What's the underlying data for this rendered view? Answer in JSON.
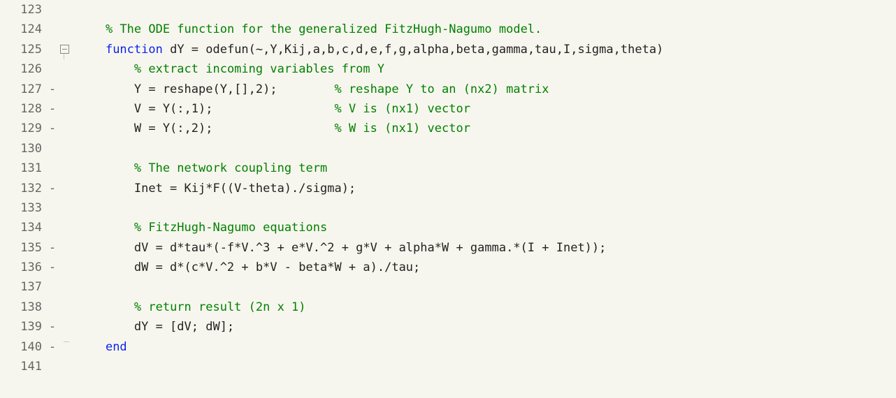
{
  "lines": [
    {
      "num": "123",
      "marker": "",
      "fold": "",
      "segs": []
    },
    {
      "num": "124",
      "marker": "",
      "fold": "",
      "segs": [
        {
          "cls": "text",
          "t": "    "
        },
        {
          "cls": "comment",
          "t": "% The ODE function for the generalized FitzHugh-Nagumo model."
        }
      ]
    },
    {
      "num": "125",
      "marker": "",
      "fold": "box",
      "segs": [
        {
          "cls": "text",
          "t": "    "
        },
        {
          "cls": "keyword",
          "t": "function "
        },
        {
          "cls": "text",
          "t": "dY = odefun(~,Y,Kij,a,b,c,d,e,f,g,alpha,beta,gamma,tau,I,sigma,theta)"
        }
      ]
    },
    {
      "num": "126",
      "marker": "",
      "fold": "line",
      "segs": [
        {
          "cls": "text",
          "t": "        "
        },
        {
          "cls": "comment",
          "t": "% extract incoming variables from Y"
        }
      ]
    },
    {
      "num": "127",
      "marker": "-",
      "fold": "line",
      "segs": [
        {
          "cls": "text",
          "t": "        Y = reshape(Y,[],2);        "
        },
        {
          "cls": "comment",
          "t": "% reshape Y to an (nx2) matrix"
        }
      ]
    },
    {
      "num": "128",
      "marker": "-",
      "fold": "line",
      "segs": [
        {
          "cls": "text",
          "t": "        V = Y(:,1);                 "
        },
        {
          "cls": "comment",
          "t": "% V is (nx1) vector"
        }
      ]
    },
    {
      "num": "129",
      "marker": "-",
      "fold": "line",
      "segs": [
        {
          "cls": "text",
          "t": "        W = Y(:,2);                 "
        },
        {
          "cls": "comment",
          "t": "% W is (nx1) vector"
        }
      ]
    },
    {
      "num": "130",
      "marker": "",
      "fold": "line",
      "segs": []
    },
    {
      "num": "131",
      "marker": "",
      "fold": "line",
      "segs": [
        {
          "cls": "text",
          "t": "        "
        },
        {
          "cls": "comment",
          "t": "% The network coupling term"
        }
      ]
    },
    {
      "num": "132",
      "marker": "-",
      "fold": "line",
      "segs": [
        {
          "cls": "text",
          "t": "        Inet = Kij*F((V-theta)./sigma);"
        }
      ]
    },
    {
      "num": "133",
      "marker": "",
      "fold": "line",
      "segs": []
    },
    {
      "num": "134",
      "marker": "",
      "fold": "line",
      "segs": [
        {
          "cls": "text",
          "t": "        "
        },
        {
          "cls": "comment",
          "t": "% FitzHugh-Nagumo equations"
        }
      ]
    },
    {
      "num": "135",
      "marker": "-",
      "fold": "line",
      "segs": [
        {
          "cls": "text",
          "t": "        dV = d*tau*(-f*V.^3 + e*V.^2 + g*V + alpha*W + gamma.*(I + Inet));"
        }
      ]
    },
    {
      "num": "136",
      "marker": "-",
      "fold": "line",
      "segs": [
        {
          "cls": "text",
          "t": "        dW = d*(c*V.^2 + b*V - beta*W + a)./tau;"
        }
      ]
    },
    {
      "num": "137",
      "marker": "",
      "fold": "line",
      "segs": []
    },
    {
      "num": "138",
      "marker": "",
      "fold": "line",
      "segs": [
        {
          "cls": "text",
          "t": "        "
        },
        {
          "cls": "comment",
          "t": "% return result (2n x 1)"
        }
      ]
    },
    {
      "num": "139",
      "marker": "-",
      "fold": "line",
      "segs": [
        {
          "cls": "text",
          "t": "        dY = [dV; dW];"
        }
      ]
    },
    {
      "num": "140",
      "marker": "-",
      "fold": "end",
      "segs": [
        {
          "cls": "text",
          "t": "    "
        },
        {
          "cls": "keyword",
          "t": "end"
        }
      ]
    },
    {
      "num": "141",
      "marker": "",
      "fold": "",
      "segs": []
    }
  ]
}
